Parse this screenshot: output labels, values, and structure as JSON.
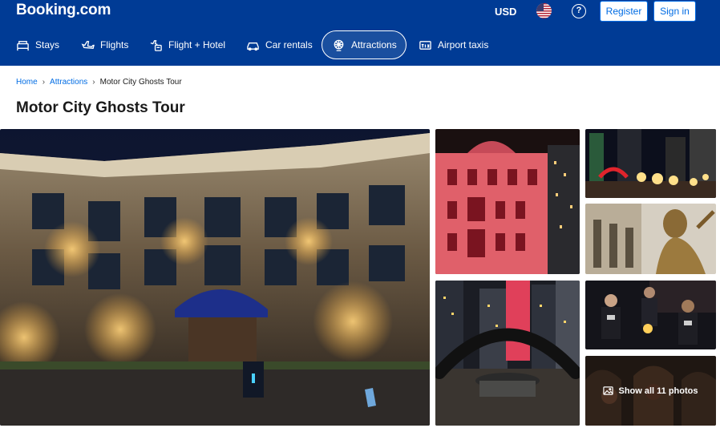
{
  "header": {
    "logo": "Booking.com",
    "currency": "USD",
    "flag_icon": "us-flag-icon",
    "help_icon": "question-mark-icon",
    "help_glyph": "?",
    "register_label": "Register",
    "signin_label": "Sign in"
  },
  "nav": {
    "items": [
      {
        "label": "Stays",
        "icon": "bed-icon"
      },
      {
        "label": "Flights",
        "icon": "airplane-icon"
      },
      {
        "label": "Flight + Hotel",
        "icon": "airplane-hotel-icon"
      },
      {
        "label": "Car rentals",
        "icon": "car-icon"
      },
      {
        "label": "Attractions",
        "icon": "ferris-wheel-icon",
        "active": true
      },
      {
        "label": "Airport taxis",
        "icon": "taxi-icon"
      }
    ]
  },
  "breadcrumb": {
    "items": [
      "Home",
      "Attractions",
      "Motor City Ghosts Tour"
    ]
  },
  "page": {
    "title": "Motor City Ghosts Tour"
  },
  "gallery": {
    "show_all_label": "Show all 11 photos",
    "show_all_icon": "image-icon"
  },
  "colors": {
    "brand_blue": "#003b95",
    "link_blue": "#006ce4"
  }
}
